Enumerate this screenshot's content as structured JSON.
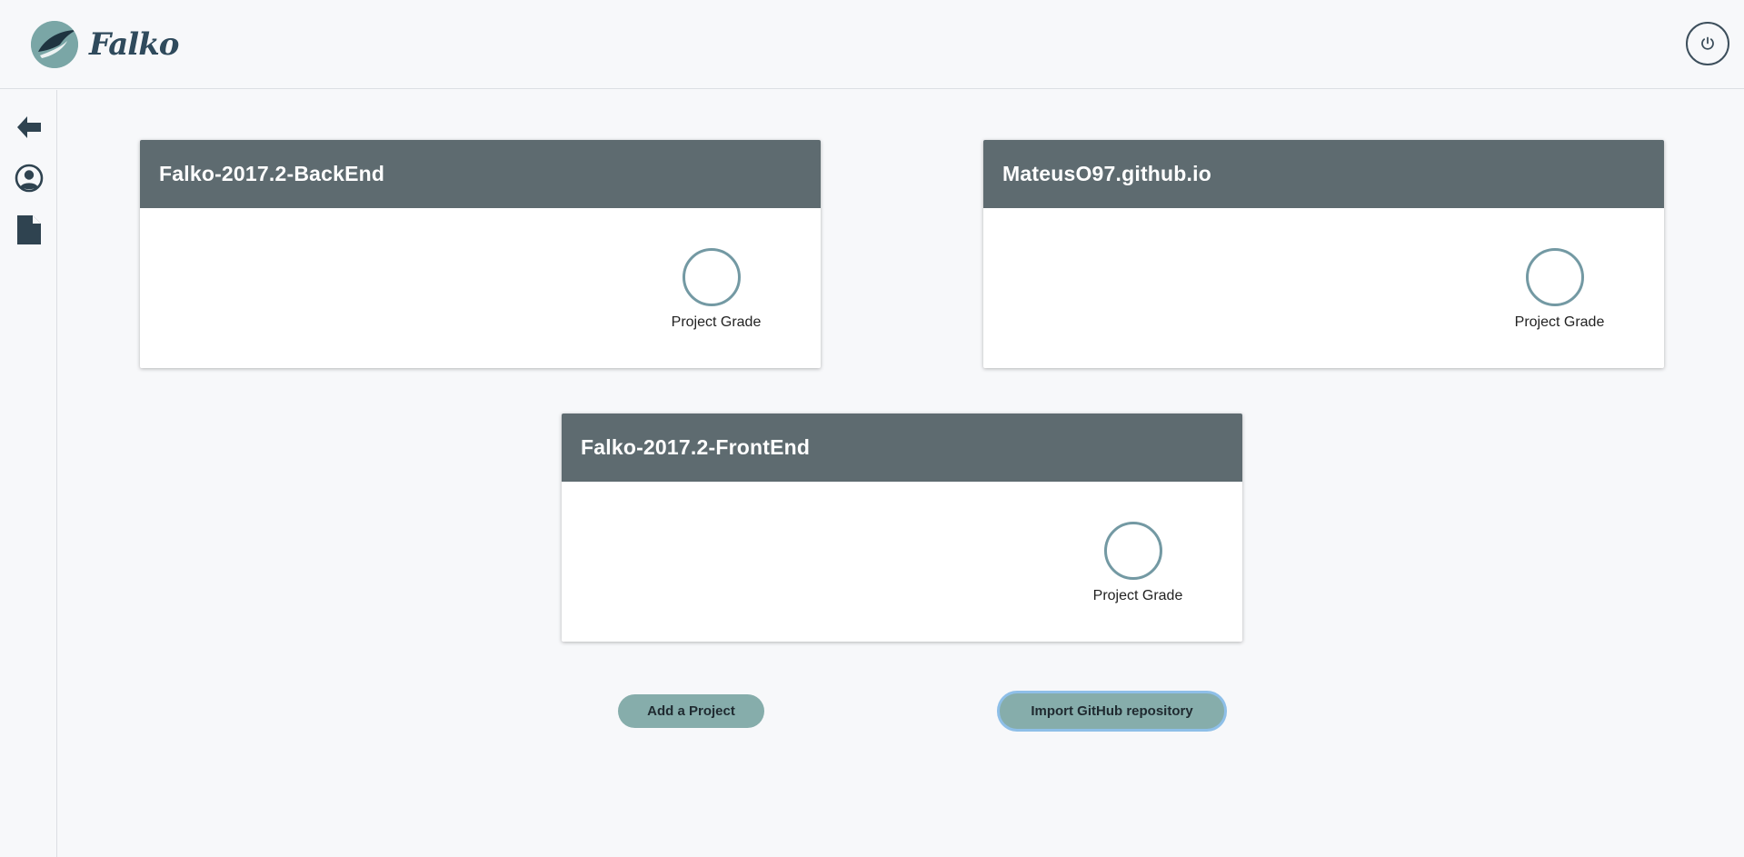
{
  "app": {
    "logo_text": "Falko",
    "power_icon": "power-icon"
  },
  "sidebar": {
    "items": [
      {
        "name": "back",
        "icon": "arrow-left-icon"
      },
      {
        "name": "profile",
        "icon": "user-circle-icon"
      },
      {
        "name": "documents",
        "icon": "document-icon"
      }
    ]
  },
  "projects": [
    {
      "title": "Falko-2017.2-BackEnd",
      "grade_label": "Project Grade"
    },
    {
      "title": "MateusO97.github.io",
      "grade_label": "Project Grade"
    },
    {
      "title": "Falko-2017.2-FrontEnd",
      "grade_label": "Project Grade"
    }
  ],
  "actions": {
    "add_project": "Add a Project",
    "import_github": "Import GitHub repository"
  },
  "colors": {
    "card_header": "#5e6b70",
    "button": "#86adab",
    "grade_ring": "#7399a3",
    "logo_text": "#2f4a5c"
  }
}
